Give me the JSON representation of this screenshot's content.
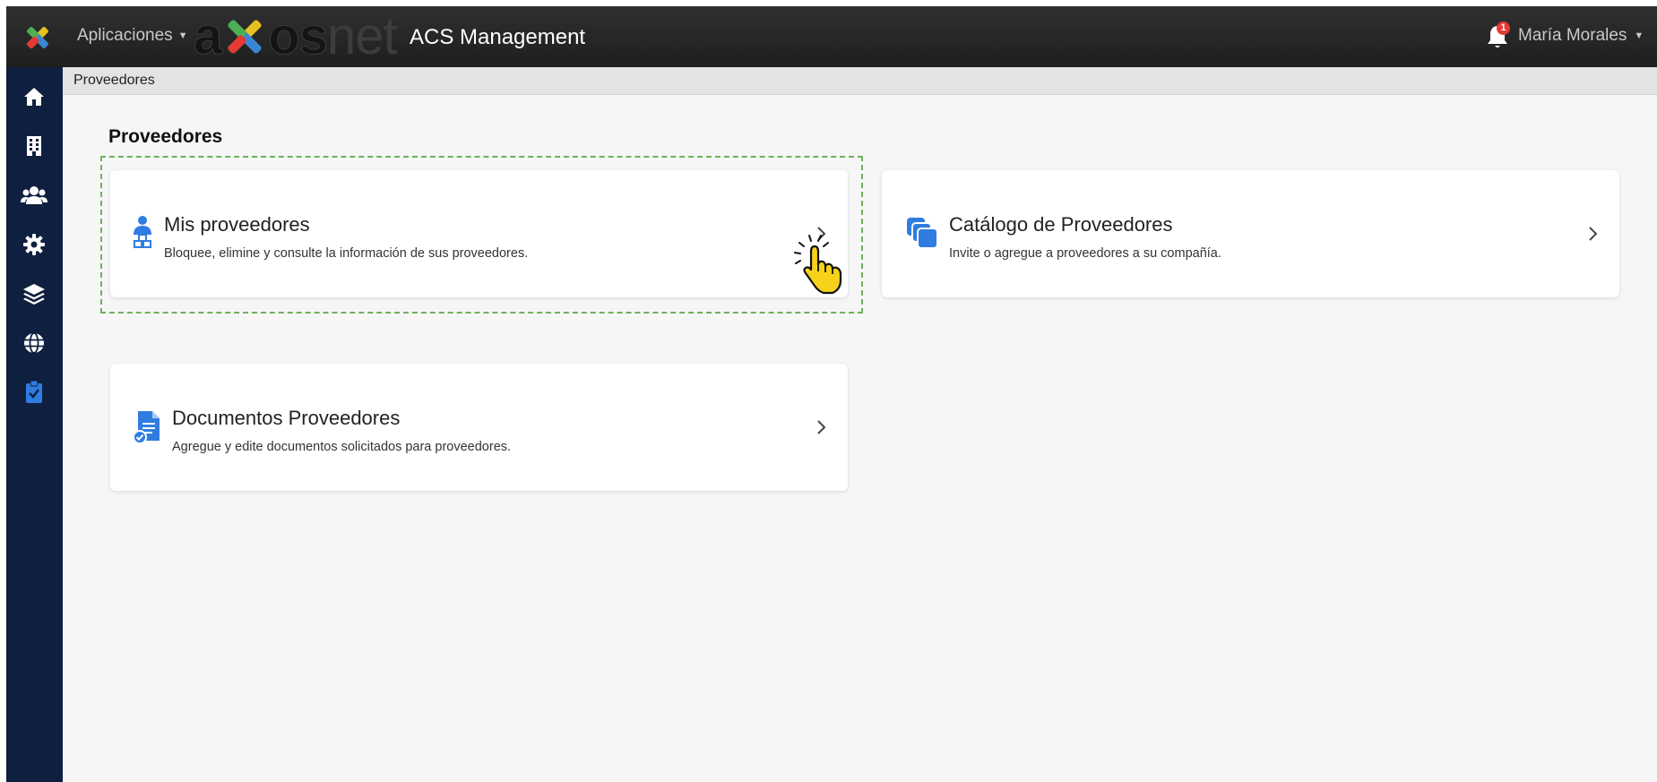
{
  "header": {
    "apps_label": "Aplicaciones",
    "brand_dark": "a",
    "brand_dark2": "os",
    "brand_light": "net",
    "product_title": "ACS Management",
    "notification_count": "1",
    "user_name": "María Morales"
  },
  "sidebar": {
    "items": [
      {
        "icon": "home-icon"
      },
      {
        "icon": "building-icon"
      },
      {
        "icon": "users-icon"
      },
      {
        "icon": "gear-icon"
      },
      {
        "icon": "layers-icon"
      },
      {
        "icon": "globe-icon"
      },
      {
        "icon": "clipboard-check-icon",
        "active": true
      }
    ],
    "active_color": "#2f7de1"
  },
  "breadcrumb": {
    "current": "Proveedores"
  },
  "main": {
    "title": "Proveedores",
    "cards": [
      {
        "title": "Mis proveedores",
        "description": "Bloquee, elimine y consulte la información de sus proveedores.",
        "icon": "supplier-user-icon"
      },
      {
        "title": "Catálogo de Proveedores",
        "description": "Invite o agregue a proveedores a su compañía.",
        "icon": "catalog-stack-icon"
      },
      {
        "title": "Documentos Proveedores",
        "description": "Agregue y edite documentos solicitados para proveedores.",
        "icon": "document-check-icon"
      }
    ]
  },
  "colors": {
    "icon_blue": "#2f7de1",
    "sidebar_bg": "#0f1f40",
    "highlight_border": "#6cb25b",
    "cursor_yellow": "#f7d21b"
  }
}
